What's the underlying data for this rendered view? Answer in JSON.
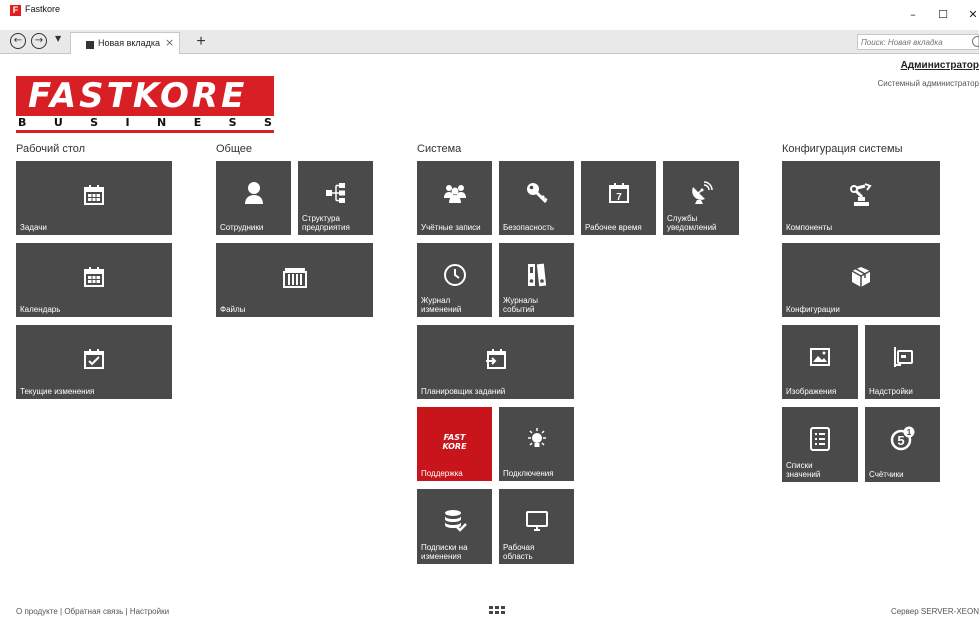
{
  "window": {
    "title": "Fastkore",
    "logo_letter": "F"
  },
  "tabbar": {
    "tab_label": "Новая вкладка",
    "search_placeholder": "Поиск: Новая вкладка"
  },
  "logo": {
    "top": "FASTKORE",
    "bottom": [
      "B",
      "U",
      "S",
      "I",
      "N",
      "E",
      "S",
      "S"
    ]
  },
  "user": {
    "name": "Администратор",
    "role": "Системный администратор"
  },
  "sections": {
    "desktop": "Рабочий стол",
    "general": "Общее",
    "system": "Система",
    "config": "Конфигурация системы"
  },
  "tiles": {
    "tasks": "Задачи",
    "calendar": "Календарь",
    "current_changes": "Текущие изменения",
    "employees": "Сотрудники",
    "structure": "Структура\nпредприятия",
    "files": "Файлы",
    "accounts": "Учётные записи",
    "security": "Безопасность",
    "work_time": "Рабочее время",
    "notifications": "Службы\nуведомлений",
    "change_log": "Журнал\nизменений",
    "event_logs": "Журналы\nсобытий",
    "scheduler": "Планировщик заданий",
    "support": "Поддержка",
    "support_mark": "FAST\nKORE",
    "connections": "Подключения",
    "subscriptions": "Подписки на\nизменения",
    "workspace": "Рабочая\nобласть",
    "components": "Компоненты",
    "configurations": "Конфигурации",
    "images": "Изображения",
    "addons": "Надстройки",
    "value_lists": "Списки\nзначений",
    "counters": "Счётчики",
    "calendar_day": "7",
    "counter_badge": "1"
  },
  "footer": {
    "about": "О продукте",
    "feedback": "Обратная связь",
    "settings": "Настройки",
    "separator": "|",
    "server": "Сервер SERVER-XEON"
  },
  "colors": {
    "tile": "#4a4a4a",
    "accent": "#c8151b",
    "brand": "#d81f26"
  }
}
